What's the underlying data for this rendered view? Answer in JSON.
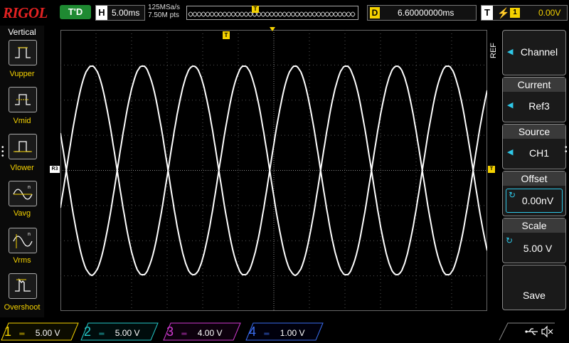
{
  "colors": {
    "ch1": "#f5d200",
    "ch2": "#24c8c8",
    "ch3": "#d13ad1",
    "ch4": "#3a6df0",
    "ref": "#ffffff",
    "trigger": "#f5d200"
  },
  "header": {
    "brand": "RIGOL",
    "status": "T'D",
    "timebase_label": "H",
    "timebase_value": "5.00ms",
    "sample_rate": "125MSa/s",
    "memory_depth": "7.50M pts",
    "delay_label": "D",
    "delay_value": "6.60000000ms",
    "trigger_label": "T",
    "trigger_source": "1",
    "trigger_level": "0.00V"
  },
  "left_menu": {
    "title": "Vertical",
    "items": [
      {
        "label": "Vupper",
        "icon": "vupper-icon"
      },
      {
        "label": "Vmid",
        "icon": "vmid-icon"
      },
      {
        "label": "Vlower",
        "icon": "vlower-icon"
      },
      {
        "label": "Vavg",
        "icon": "vavg-icon"
      },
      {
        "label": "Vrms",
        "icon": "vrms-icon"
      },
      {
        "label": "Overshoot",
        "icon": "overshoot-icon"
      }
    ]
  },
  "screen": {
    "ref_marker": "R3",
    "trigger_marker": "T"
  },
  "right_menu": {
    "section": "REF",
    "channel_label": "Channel",
    "current_label": "Current",
    "current_value": "Ref3",
    "source_label": "Source",
    "source_value": "CH1",
    "offset_label": "Offset",
    "offset_value": "0.00nV",
    "scale_label": "Scale",
    "scale_value": "5.00 V",
    "save_label": "Save"
  },
  "channels": [
    {
      "num": "1",
      "scale": "5.00 V"
    },
    {
      "num": "2",
      "scale": "5.00 V"
    },
    {
      "num": "3",
      "scale": "4.00 V"
    },
    {
      "num": "4",
      "scale": "1.00 V"
    }
  ],
  "status_icons": [
    "usb-icon",
    "speaker-muted-icon"
  ]
}
